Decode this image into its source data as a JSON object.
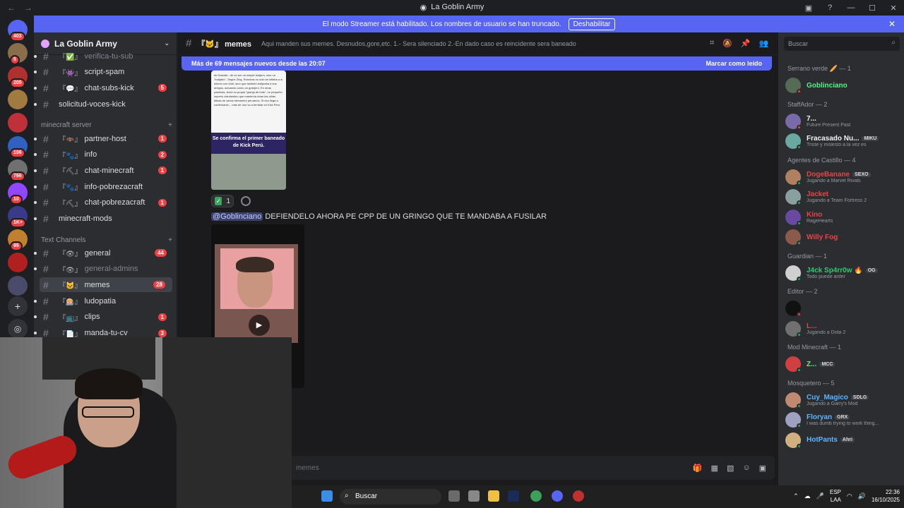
{
  "window": {
    "title": "La Goblin Army"
  },
  "banner": {
    "text": "El modo Streamer está habilitado. Los nombres de usuario se han truncado.",
    "button": "Deshabilitar"
  },
  "servers": [
    {
      "badge": "403",
      "color": "#5865f2"
    },
    {
      "badge": "5",
      "color": "#8a6d4a"
    },
    {
      "badge": "205",
      "color": "#b03030"
    },
    {
      "badge": "",
      "color": "#a07a40"
    },
    {
      "badge": "",
      "color": "#c0303a"
    },
    {
      "badge": "106",
      "color": "#3060c0"
    },
    {
      "badge": "766",
      "color": "#707070"
    },
    {
      "badge": "10",
      "color": "#9146ff"
    },
    {
      "badge": "1K+",
      "color": "#3a3a8a"
    },
    {
      "badge": "95",
      "color": "#c08030"
    },
    {
      "badge": "",
      "color": "#b02020"
    },
    {
      "badge": "",
      "color": "#4a4a6a"
    }
  ],
  "sidebar": {
    "guild_name": "La Goblin Army",
    "channels": [
      {
        "prefix": "『✅』",
        "name": "verifica-tu-sub",
        "badge": "",
        "muted": true
      },
      {
        "prefix": "『👾』",
        "name": "script-spam",
        "badge": "",
        "muted": false
      },
      {
        "prefix": "『💬』",
        "name": "chat-subs-kick",
        "badge": "5",
        "muted": false
      },
      {
        "prefix": "",
        "name": "solicitud-voces-kick",
        "badge": "",
        "muted": false
      }
    ],
    "cat_minecraft": "minecraft server",
    "minecraft": [
      {
        "prefix": "『🦇』",
        "name": "partner-host",
        "badge": "1"
      },
      {
        "prefix": "『🐾』",
        "name": "info",
        "badge": "2"
      },
      {
        "prefix": "『⛏』",
        "name": "chat-minecraft",
        "badge": "1"
      },
      {
        "prefix": "『🐾』",
        "name": "info-pobrezacraft",
        "badge": ""
      },
      {
        "prefix": "『⛏』",
        "name": "chat-pobrezacraft",
        "badge": "1"
      },
      {
        "prefix": "",
        "name": "minecraft-mods",
        "badge": ""
      }
    ],
    "cat_text": "Text Channels",
    "text": [
      {
        "prefix": "『👁』",
        "name": "general",
        "badge": "44",
        "muted": false,
        "sel": false
      },
      {
        "prefix": "『👁』",
        "name": "general-admins",
        "badge": "",
        "muted": true,
        "sel": false
      },
      {
        "prefix": "『🐱』",
        "name": "memes",
        "badge": "28",
        "muted": false,
        "sel": true
      },
      {
        "prefix": "『🎰』",
        "name": "ludopatia",
        "badge": "",
        "muted": false,
        "sel": false
      },
      {
        "prefix": "『📺』",
        "name": "clips",
        "badge": "1",
        "muted": false,
        "sel": false
      },
      {
        "prefix": "『📄』",
        "name": "manda-tu-cv",
        "badge": "3",
        "muted": false,
        "sel": false
      }
    ]
  },
  "channel": {
    "prefix": "『🐱』",
    "name": "memes",
    "topic": "Aqui manden sus memes. Desnudos,gore,etc. 1.- Sera silenciado 2.-En dado caso es reincidente sera baneado"
  },
  "new_messages": {
    "text": "Más de 69 mensajes nuevos desde las 20:07",
    "mark": "Marcar como leído"
  },
  "messages": {
    "image_text": "de Dwarde– de no ser un simple botijero, sino un \"botijabo\". Según Zing, Ronchas no solo se inflaba a sí mismo con bots, sino que también botijeaba a sus amigos, actuando como un granjero. En otras palabras, tenía su propia \"granja de bots\", un pequeño imperio clandestino que mantenía vivas las cifras falsas de varios streamers peruanos. Si eso llega a confirmarse... más de uno va a temblar en Kick Perú.",
    "image_headline": "Se confirma el primer baneado de Kick Perú.",
    "reaction_count": "1",
    "mention": "@Goblinciano",
    "text": "DEFIENDELO AHORA PE CPP DE UN GRINGO QUE TE MANDABA A FUSILAR"
  },
  "composer": {
    "placeholder": "memes"
  },
  "members": {
    "search": "Buscar",
    "groups": [
      {
        "title": "Serrano verde 🥖 — 1",
        "members": [
          {
            "name": "Goblinciano",
            "color": "#57f287",
            "status": "",
            "tag": "",
            "dot": "dnd",
            "av": "#556b55"
          }
        ]
      },
      {
        "title": "StaffAdor — 2",
        "members": [
          {
            "name": "7...",
            "color": "#f2f3f5",
            "status": "Future Present Past",
            "tag": "",
            "dot": "dnd",
            "av": "#7a6aa8"
          },
          {
            "name": "Fracasado Nu...",
            "color": "#f2f3f5",
            "status": "Triste y molesto a la vez es",
            "tag": "MIKU",
            "dot": "online",
            "av": "#6aa8a0"
          }
        ]
      },
      {
        "title": "Agentes de Castillo — 4",
        "members": [
          {
            "name": "DogeBanane",
            "color": "#ed4245",
            "status": "Jugando a Marvel Rivals",
            "tag": "SEXO",
            "dot": "online",
            "av": "#b08060"
          },
          {
            "name": "Jacket",
            "color": "#ed4245",
            "status": "Jugando a Team Fortress 2",
            "tag": "",
            "dot": "online",
            "av": "#8aa0a0"
          },
          {
            "name": "Kino",
            "color": "#ed4245",
            "status": "RageHearts",
            "tag": "",
            "dot": "online",
            "av": "#6a4aa0"
          },
          {
            "name": "Willy Fog",
            "color": "#ed4245",
            "status": "",
            "tag": "",
            "dot": "online",
            "av": "#8a5a4a"
          }
        ]
      },
      {
        "title": "Guardian — 1",
        "members": [
          {
            "name": "J4ck Sp4rr0w 🔥",
            "color": "#2ecc71",
            "status": "Todo puede arder",
            "tag": "OG",
            "dot": "online",
            "av": "#d0d0d0"
          }
        ]
      },
      {
        "title": "Editor — 2",
        "members": [
          {
            "name": "",
            "color": "#f2f3f5",
            "status": "",
            "tag": "",
            "dot": "dnd",
            "av": "#111111"
          },
          {
            "name": "L...",
            "color": "#ed4245",
            "status": "Jugando a Dota 2",
            "tag": "",
            "dot": "online",
            "av": "#707070"
          }
        ]
      },
      {
        "title": "Mod Minecraft — 1",
        "members": [
          {
            "name": "Z...",
            "color": "#57f287",
            "status": "",
            "tag": "MCC",
            "dot": "online",
            "av": "#d04040"
          }
        ]
      },
      {
        "title": "Mosquetero — 5",
        "members": [
          {
            "name": "Cuy_Magico",
            "color": "#5fb4ff",
            "status": "Jugando a Garry's Mod",
            "tag": "SDLG",
            "dot": "online",
            "av": "#c08a70"
          },
          {
            "name": "Floryan",
            "color": "#5fb4ff",
            "status": "I was dumb trying to work thing...",
            "tag": "GRX",
            "dot": "online",
            "av": "#a0a0c0"
          },
          {
            "name": "HotPants",
            "color": "#5fb4ff",
            "status": "",
            "tag": "Ahri",
            "dot": "online",
            "av": "#d0b080"
          }
        ]
      }
    ]
  },
  "taskbar": {
    "search": "Buscar",
    "lang1": "ESP",
    "lang2": "LAA",
    "time": "22:36",
    "date": "16/10/2025"
  }
}
